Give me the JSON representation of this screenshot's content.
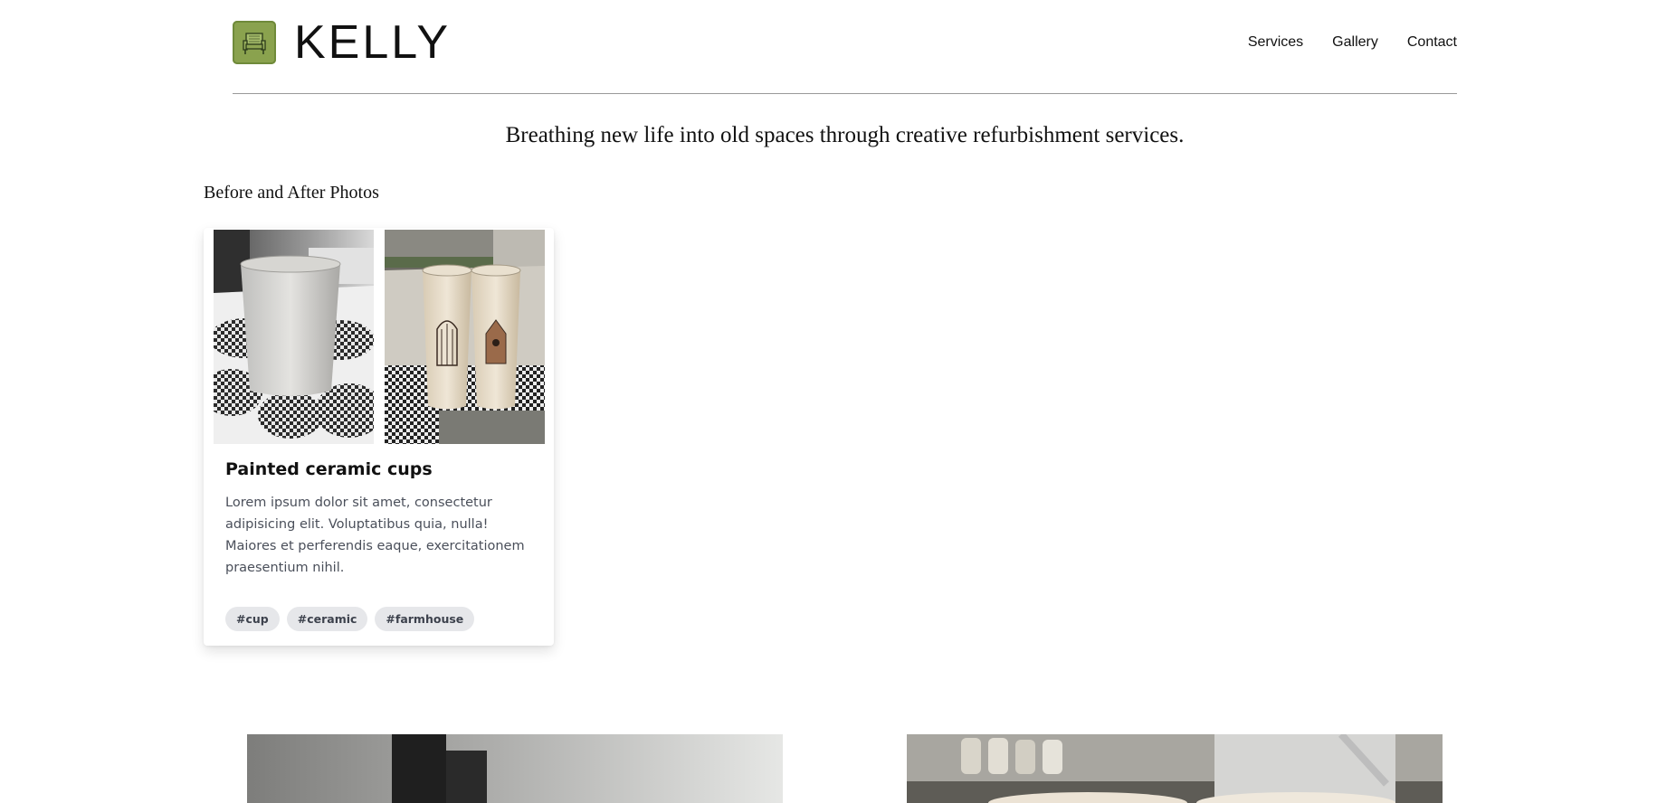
{
  "header": {
    "brand": "KELLY",
    "logo_icon": "armchair-icon",
    "nav": [
      {
        "label": "Services"
      },
      {
        "label": "Gallery"
      },
      {
        "label": "Contact"
      }
    ]
  },
  "hero": {
    "tagline": "Breathing new life into old spaces through creative refurbishment services."
  },
  "gallery": {
    "section_title": "Before and After Photos",
    "cards": [
      {
        "title": "Painted ceramic cups",
        "description": "Lorem ipsum dolor sit amet, consectetur adipisicing elit. Voluptatibus quia, nulla! Maiores et perferendis eaque, exercitationem praesentium nihil.",
        "tags": [
          "#cup",
          "#ceramic",
          "#farmhouse"
        ]
      }
    ]
  },
  "colors": {
    "logo_green": "#8aa24e",
    "tag_bg": "#e6e7ea",
    "rule": "#9a9a9a"
  }
}
